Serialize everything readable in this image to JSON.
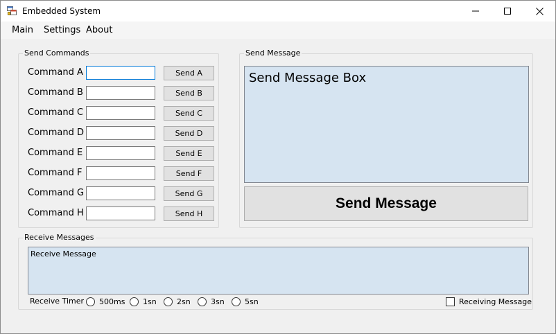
{
  "window": {
    "title": "Embedded System",
    "icon": "app-window-icon",
    "controls": [
      "minimize-icon",
      "maximize-icon",
      "close-icon"
    ]
  },
  "menu": {
    "items": [
      {
        "label": "Main"
      },
      {
        "label": "Settings"
      },
      {
        "label": "About"
      }
    ]
  },
  "send_commands": {
    "title": "Send Commands",
    "rows": [
      {
        "label": "Command A",
        "value": "",
        "button": "Send A"
      },
      {
        "label": "Command B",
        "value": "",
        "button": "Send B"
      },
      {
        "label": "Command C",
        "value": "",
        "button": "Send C"
      },
      {
        "label": "Command D",
        "value": "",
        "button": "Send D"
      },
      {
        "label": "Command E",
        "value": "",
        "button": "Send E"
      },
      {
        "label": "Command F",
        "value": "",
        "button": "Send F"
      },
      {
        "label": "Command G",
        "value": "",
        "button": "Send G"
      },
      {
        "label": "Command H",
        "value": "",
        "button": "Send H"
      }
    ]
  },
  "send_message": {
    "title": "Send Message",
    "box_text": "Send Message Box",
    "button": "Send Message"
  },
  "receive_messages": {
    "title": "Receive Messages",
    "box_text": "Receive Message",
    "timer_label": "Receive Timer",
    "timer_options": [
      "500ms",
      "1sn",
      "2sn",
      "3sn",
      "5sn"
    ],
    "checkbox_label": "Receiving Message",
    "checkbox_checked": false
  },
  "colors": {
    "textbox_background": "#d6e4f1",
    "button_background": "#e1e1e1",
    "window_background": "#f0f0f0",
    "focus_border": "#0078d7"
  }
}
